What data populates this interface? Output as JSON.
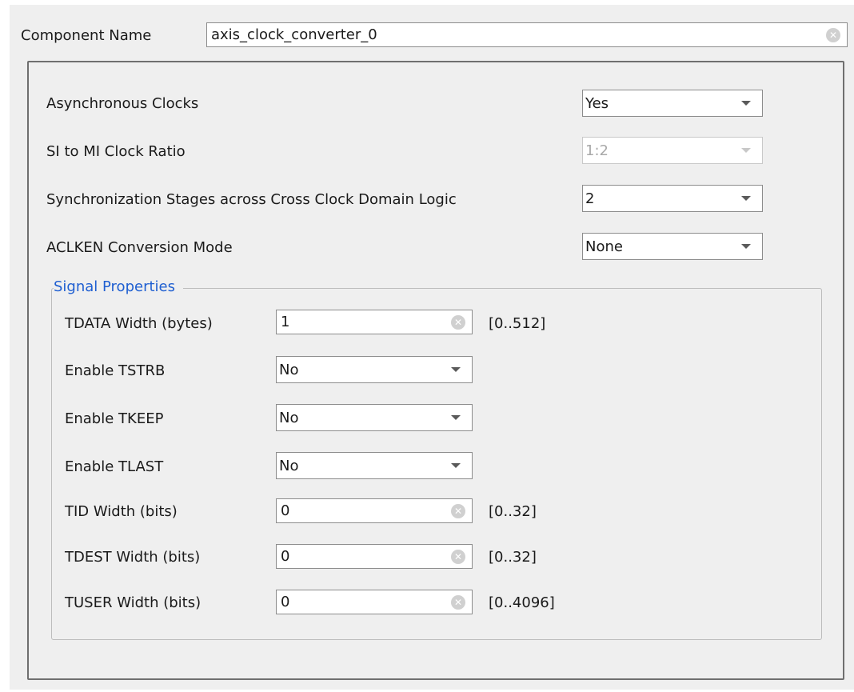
{
  "component": {
    "label": "Component Name",
    "value": "axis_clock_converter_0"
  },
  "settings": [
    {
      "label": "Asynchronous Clocks",
      "value": "Yes",
      "enabled": true
    },
    {
      "label": "SI to MI Clock Ratio",
      "value": "1:2",
      "enabled": false
    },
    {
      "label": "Synchronization Stages across Cross Clock Domain Logic",
      "value": "2",
      "enabled": true
    },
    {
      "label": "ACLKEN Conversion Mode",
      "value": "None",
      "enabled": true
    }
  ],
  "signal_properties": {
    "title": "Signal Properties",
    "tdata": {
      "label": "TDATA Width (bytes)",
      "value": "1",
      "range": "[0..512]"
    },
    "tstrb": {
      "label": "Enable TSTRB",
      "value": "No"
    },
    "tkeep": {
      "label": "Enable TKEEP",
      "value": "No"
    },
    "tlast": {
      "label": "Enable TLAST",
      "value": "No"
    },
    "tid": {
      "label": "TID Width (bits)",
      "value": "0",
      "range": "[0..32]"
    },
    "tdest": {
      "label": "TDEST Width (bits)",
      "value": "0",
      "range": "[0..32]"
    },
    "tuser": {
      "label": "TUSER Width (bits)",
      "value": "0",
      "range": "[0..4096]"
    }
  },
  "icons": {
    "clear": "clear-icon",
    "dropdown": "caret-down-icon"
  },
  "colors": {
    "accent": "#1f5fd1",
    "disabled_text": "#a9a9a9"
  }
}
